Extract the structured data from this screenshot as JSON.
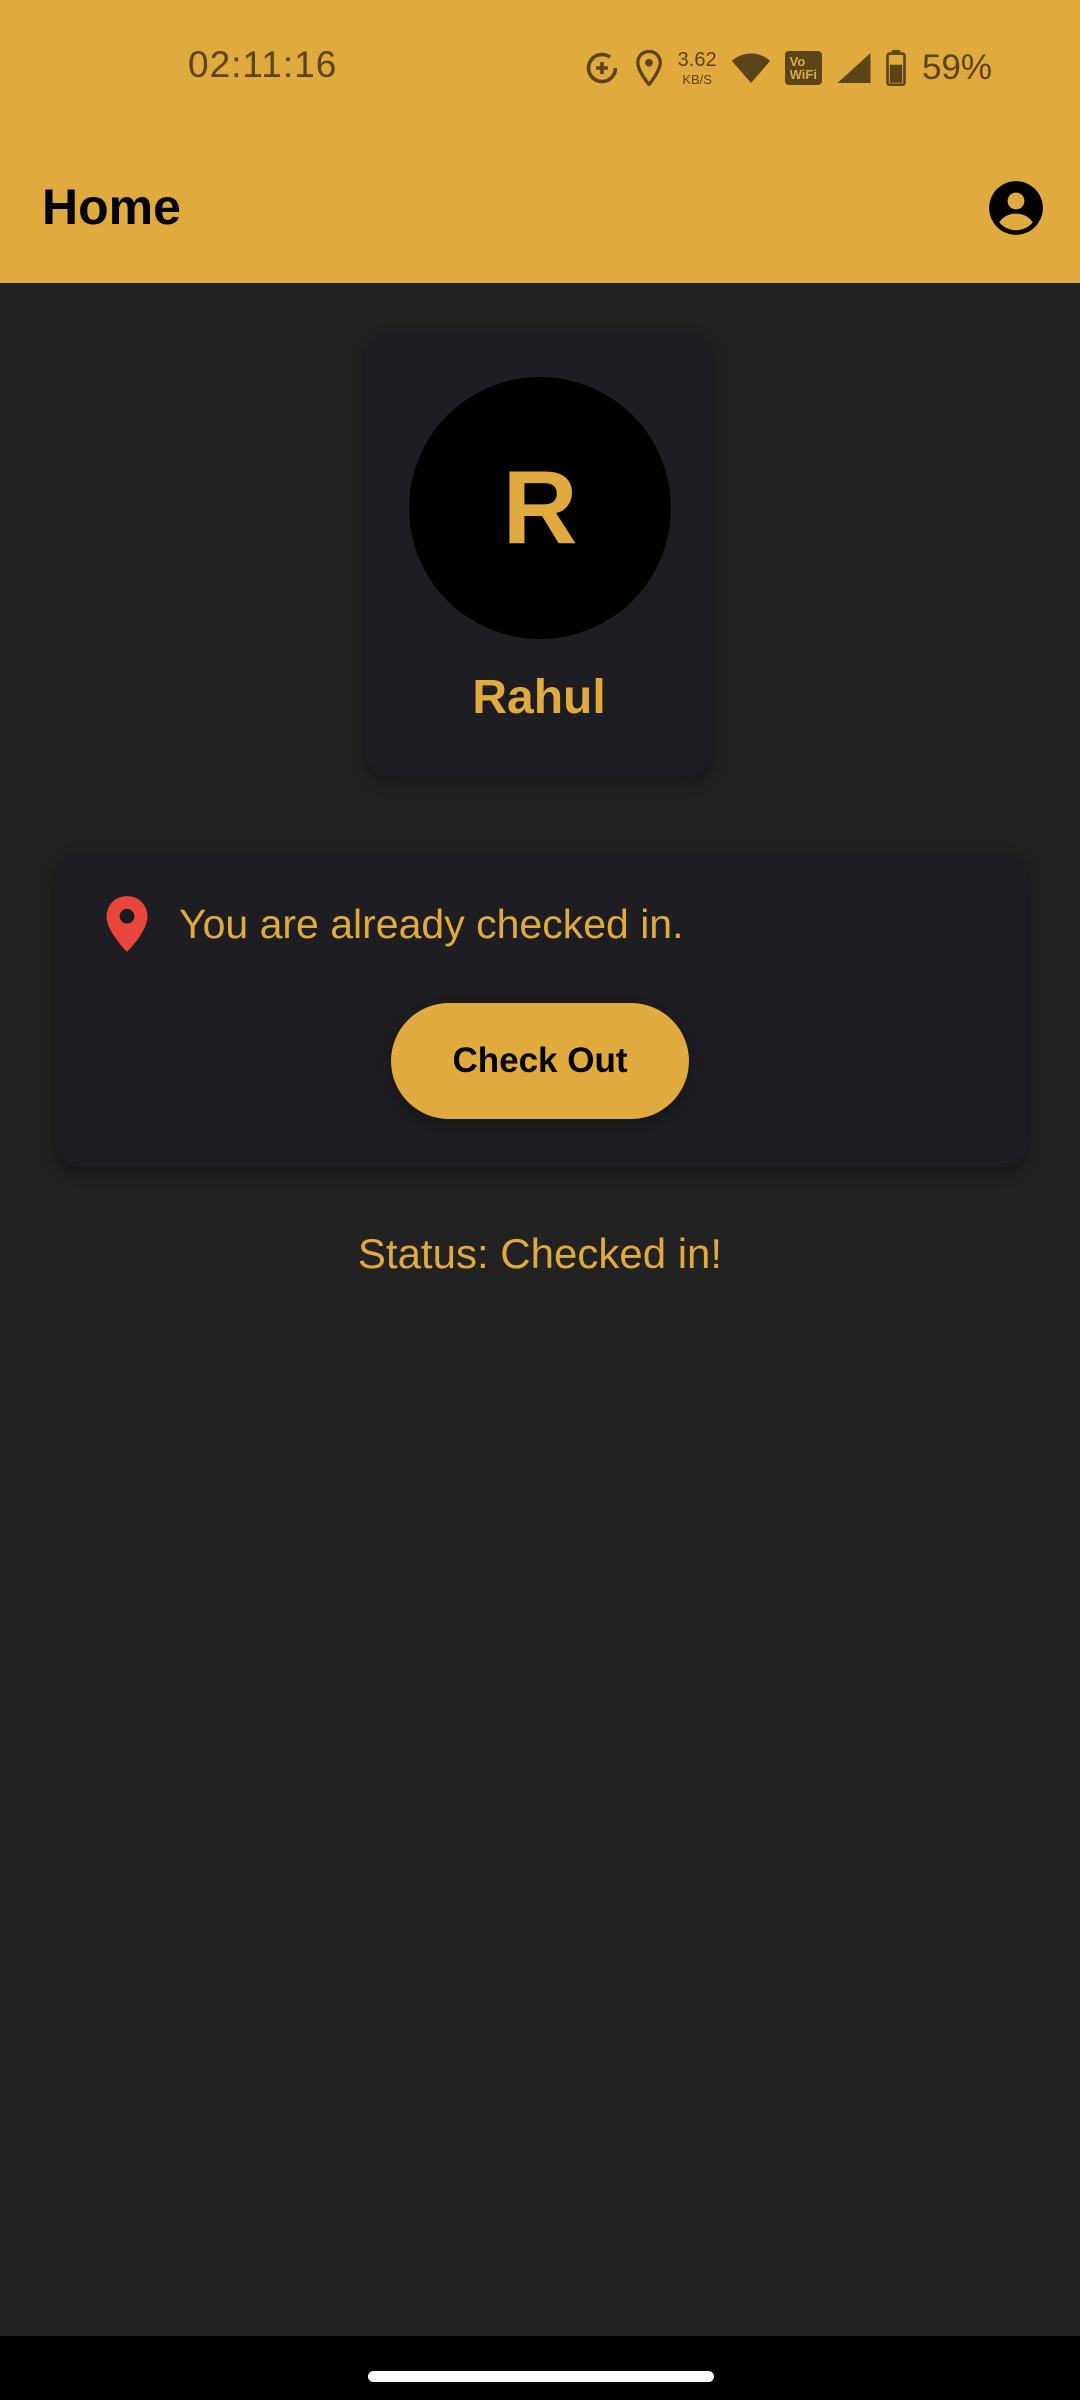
{
  "status_bar": {
    "time": "02:11:16",
    "net_speed_value": "3.62",
    "net_speed_unit": "KB/S",
    "vowifi_top": "Vo",
    "vowifi_bottom": "WiFi",
    "battery": "59%",
    "icons": [
      "data-saver-icon",
      "location-icon",
      "wifi-icon",
      "vowifi-icon",
      "signal-icon",
      "battery-icon"
    ]
  },
  "app_bar": {
    "title": "Home",
    "account_icon": "account-circle-icon"
  },
  "profile": {
    "initial": "R",
    "name": "Rahul"
  },
  "checkin": {
    "icon": "location-pin-icon",
    "message": "You are already checked in.",
    "button_label": "Check Out"
  },
  "status": {
    "text": "Status: Checked in!"
  },
  "colors": {
    "accent": "#e0aa3e",
    "background": "#222222",
    "card": "#1e1d22",
    "pin": "#e8453c"
  }
}
